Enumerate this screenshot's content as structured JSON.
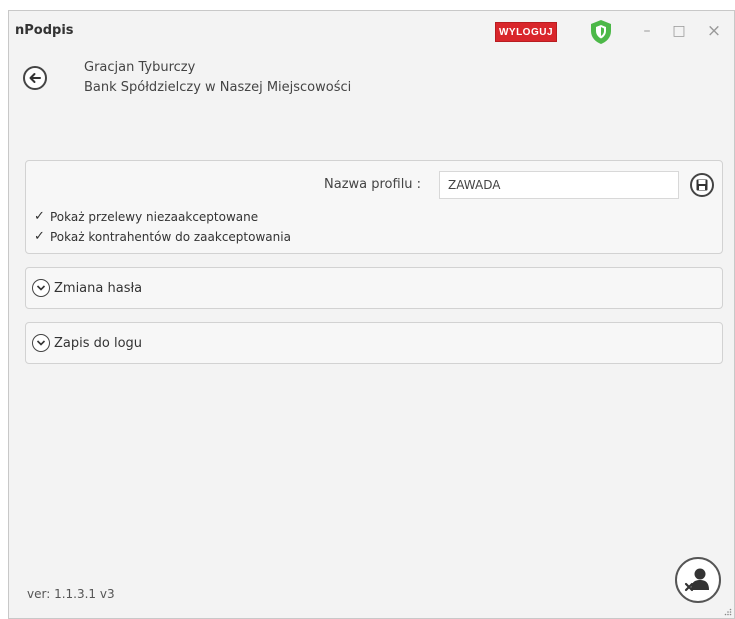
{
  "window": {
    "title": "nPodpis",
    "logout_label": "WYLOGUJ",
    "accent_color": "#d9262b",
    "shield_color": "#4cb848"
  },
  "header": {
    "user_name": "Gracjan  Tyburczy",
    "bank_name": "Bank Spółdzielczy w Naszej Miejscowości"
  },
  "profile": {
    "label": "Nazwa profilu :",
    "value": "ZAWADA",
    "options": [
      {
        "label": "Pokaż przelewy niezaakceptowane",
        "checked": true
      },
      {
        "label": "Pokaż kontrahentów do zaakceptowania",
        "checked": true
      }
    ]
  },
  "sections": {
    "password": "Zmiana hasła",
    "log": "Zapis do logu"
  },
  "footer": {
    "version": "ver: 1.1.3.1  v3"
  }
}
